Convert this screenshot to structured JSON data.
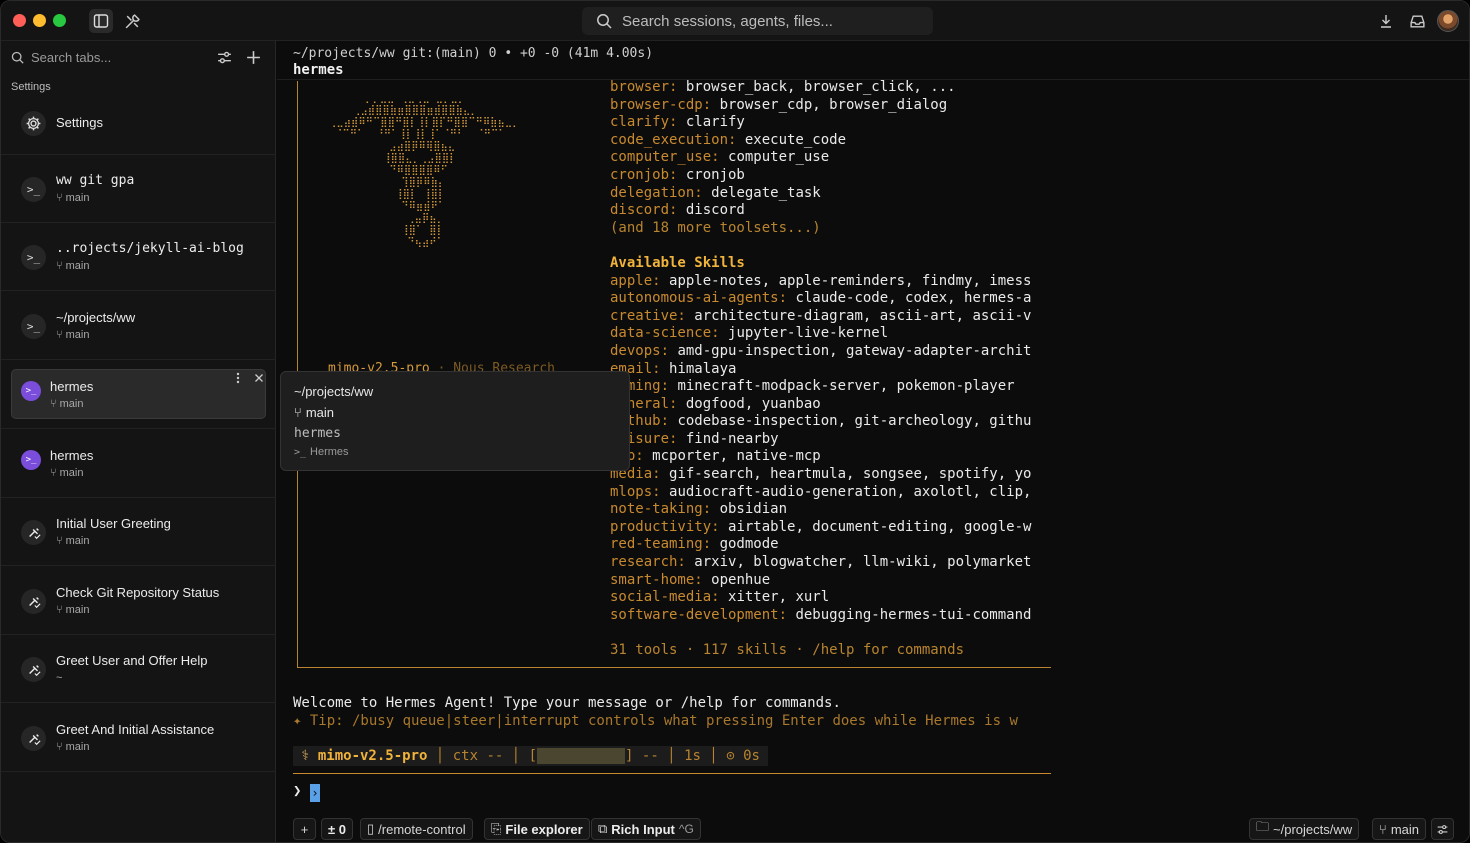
{
  "titlebar": {
    "search_placeholder": "Search sessions, agents, files..."
  },
  "sidebar": {
    "search_placeholder": "Search tabs...",
    "section_label": "Settings",
    "settings_label": "Settings",
    "items": [
      {
        "title": "ww git gpa",
        "branch": "main",
        "kind": "terminal"
      },
      {
        "title": "..rojects/jekyll-ai-blog",
        "branch": "main",
        "kind": "terminal"
      },
      {
        "title": "~/projects/ww",
        "branch": "main",
        "kind": "terminal"
      },
      {
        "title": "hermes",
        "branch": "main",
        "kind": "hermes"
      },
      {
        "title": "hermes",
        "branch": "main",
        "kind": "hermes"
      },
      {
        "title": "Initial User Greeting",
        "branch": "main",
        "kind": "agent"
      },
      {
        "title": "Check Git Repository Status",
        "branch": "main",
        "kind": "agent"
      },
      {
        "title": "Greet User and Offer Help",
        "branch": "~",
        "kind": "agent"
      },
      {
        "title": "Greet And Initial Assistance",
        "branch": "main",
        "kind": "agent"
      }
    ]
  },
  "terminal": {
    "path": "~/projects/ww git:(main) 0 • +0 -0 (41m 4.00s)",
    "title": "hermes",
    "model_line": "mimo-v2.5-pro · Nous Research",
    "model_name": "mimo-v2.5-pro",
    "model_sep": " · ",
    "model_org": "Nous Research",
    "tool_rows": [
      {
        "k": "browser: ",
        "v": "browser_back, browser_click, ..."
      },
      {
        "k": "browser-cdp: ",
        "v": "browser_cdp, browser_dialog"
      },
      {
        "k": "clarify: ",
        "v": "clarify"
      },
      {
        "k": "code_execution: ",
        "v": "execute_code"
      },
      {
        "k": "computer_use: ",
        "v": "computer_use"
      },
      {
        "k": "cronjob: ",
        "v": "cronjob"
      },
      {
        "k": "delegation: ",
        "v": "delegate_task"
      },
      {
        "k": "discord: ",
        "v": "discord"
      }
    ],
    "more_toolsets": "(and 18 more toolsets...)",
    "skills_heading": "Available Skills",
    "skill_rows": [
      {
        "k": "apple: ",
        "v": "apple-notes, apple-reminders, findmy, imess"
      },
      {
        "k": "autonomous-ai-agents: ",
        "v": "claude-code, codex, hermes-a"
      },
      {
        "k": "creative: ",
        "v": "architecture-diagram, ascii-art, ascii-v"
      },
      {
        "k": "data-science: ",
        "v": "jupyter-live-kernel"
      },
      {
        "k": "devops: ",
        "v": "amd-gpu-inspection, gateway-adapter-archit"
      },
      {
        "k": "email: ",
        "v": "himalaya"
      },
      {
        "k": "gaming: ",
        "v": "minecraft-modpack-server, pokemon-player"
      },
      {
        "k": "general: ",
        "v": "dogfood, yuanbao"
      },
      {
        "k": "github: ",
        "v": "codebase-inspection, git-archeology, githu"
      },
      {
        "k": "leisure: ",
        "v": "find-nearby"
      },
      {
        "k": "mcp: ",
        "v": "mcporter, native-mcp"
      },
      {
        "k": "media: ",
        "v": "gif-search, heartmula, songsee, spotify, yo"
      },
      {
        "k": "mlops: ",
        "v": "audiocraft-audio-generation, axolotl, clip,"
      },
      {
        "k": "note-taking: ",
        "v": "obsidian"
      },
      {
        "k": "productivity: ",
        "v": "airtable, document-editing, google-w"
      },
      {
        "k": "red-teaming: ",
        "v": "godmode"
      },
      {
        "k": "research: ",
        "v": "arxiv, blogwatcher, llm-wiki, polymarket"
      },
      {
        "k": "smart-home: ",
        "v": "openhue"
      },
      {
        "k": "social-media: ",
        "v": "xitter, xurl"
      },
      {
        "k": "software-development: ",
        "v": "debugging-hermes-tui-command"
      }
    ],
    "summary": "31 tools · 117 skills · /help for commands",
    "welcome": "Welcome to Hermes Agent! Type your message or /help for commands.",
    "tip": "✦ Tip: /busy queue|steer|interrupt controls what pressing Enter does while Hermes is w",
    "status": {
      "model": "mimo-v2.5-pro",
      "ctx": "ctx --",
      "bar_open": "[",
      "bar_close": "] --",
      "time1": "1s",
      "time2": "⊙ 0s"
    },
    "prompt_symbol": "❯"
  },
  "popup": {
    "path": "~/projects/ww",
    "branch": "main",
    "name": "hermes",
    "type": "Hermes"
  },
  "bottombar": {
    "plus": "+",
    "diff": "± 0",
    "remote": "/remote-control",
    "file_explorer": "File explorer",
    "rich_input": "Rich Input",
    "rich_input_kbd": "^G",
    "cwd": "~/projects/ww",
    "branch": "main"
  }
}
